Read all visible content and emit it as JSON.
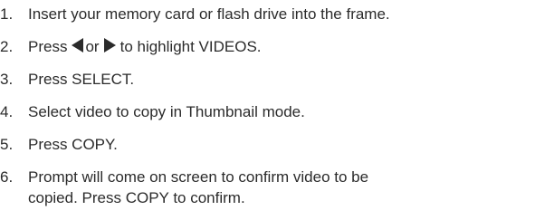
{
  "steps": [
    {
      "number": "1.",
      "text": "Insert your memory card or flash drive into the frame."
    },
    {
      "number": "2.",
      "text_before": "Press",
      "text_mid": "or",
      "text_after": "to highlight VIDEOS."
    },
    {
      "number": "3.",
      "text": "Press SELECT."
    },
    {
      "number": "4.",
      "text": "Select video to copy in Thumbnail mode."
    },
    {
      "number": "5.",
      "text": "Press COPY."
    },
    {
      "number": "6.",
      "line1": "Prompt will come on screen to confirm video to be",
      "line2": "copied. Press COPY to confirm."
    }
  ],
  "icons": {
    "left_arrow": "left-triangle-icon",
    "right_arrow": "right-triangle-icon"
  }
}
